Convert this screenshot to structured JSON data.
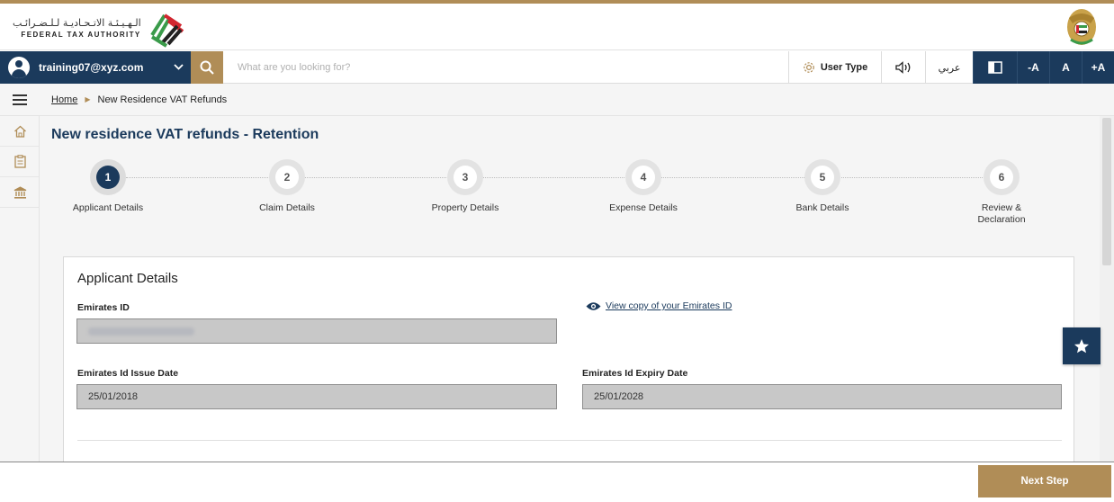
{
  "header": {
    "logo_arabic": "الـهـيـئـة الاتـحـاديـة لـلـضـرائـب",
    "logo_english": "FEDERAL TAX AUTHORITY"
  },
  "toolbar": {
    "user_email": "training07@xyz.com",
    "search_placeholder": "What are you looking for?",
    "user_type_label": "User Type",
    "language_label": "عربي",
    "font_decrease": "-A",
    "font_normal": "A",
    "font_increase": "+A"
  },
  "breadcrumb": {
    "home": "Home",
    "current": "New Residence VAT Refunds"
  },
  "page": {
    "title": "New residence VAT refunds - Retention"
  },
  "steps": [
    {
      "number": "1",
      "label": "Applicant Details",
      "active": true
    },
    {
      "number": "2",
      "label": "Claim Details",
      "active": false
    },
    {
      "number": "3",
      "label": "Property Details",
      "active": false
    },
    {
      "number": "4",
      "label": "Expense Details",
      "active": false
    },
    {
      "number": "5",
      "label": "Bank Details",
      "active": false
    },
    {
      "number": "6",
      "label": "Review &\nDeclaration",
      "active": false
    }
  ],
  "applicant": {
    "section_title": "Applicant Details",
    "emirates_id_label": "Emirates ID",
    "view_copy_link": "View copy of your Emirates ID",
    "issue_date_label": "Emirates Id Issue Date",
    "issue_date_value": "25/01/2018",
    "expiry_date_label": "Emirates Id Expiry Date",
    "expiry_date_value": "25/01/2028"
  },
  "footer": {
    "next_label": "Next Step"
  },
  "colors": {
    "navy": "#1b3a5c",
    "gold": "#b08d57",
    "field_bg": "#c8c8c8"
  }
}
